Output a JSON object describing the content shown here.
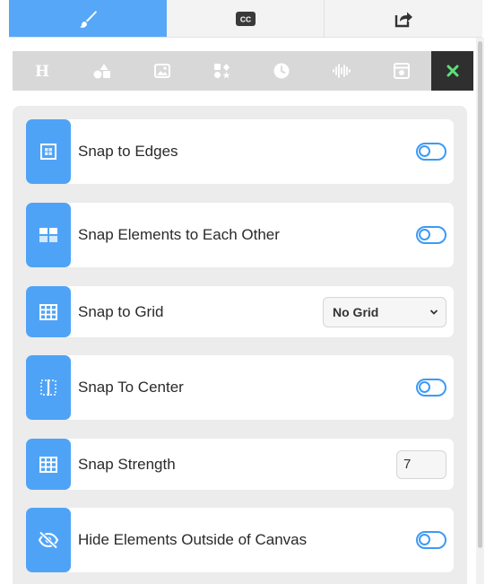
{
  "top_tabs": [
    {
      "icon": "paintbrush-icon",
      "active": true
    },
    {
      "icon": "closed-captions-icon",
      "active": false
    },
    {
      "icon": "share-icon",
      "active": false
    }
  ],
  "toolbar": {
    "tools": [
      "heading-icon",
      "shapes-icon",
      "image-icon",
      "elements-icon",
      "clock-icon",
      "audio-wave-icon",
      "widget-icon"
    ],
    "close_icon": "close-icon"
  },
  "colors": {
    "accent": "#4fa3f7",
    "toolbar_bg": "#d8d8d8",
    "close_bg": "#2f2f2f",
    "close_fg": "#5ee07a"
  },
  "settings": [
    {
      "label": "Snap to Edges",
      "control": "toggle",
      "icon": "snap-edges-icon"
    },
    {
      "label": "Snap Elements to Each Other",
      "control": "toggle",
      "icon": "snap-elements-icon"
    },
    {
      "label": "Snap to Grid",
      "control": "select",
      "value": "No Grid",
      "icon": "grid-icon"
    },
    {
      "label": "Snap To Center",
      "control": "toggle",
      "icon": "snap-center-icon"
    },
    {
      "label": "Snap Strength",
      "control": "number",
      "value": "7",
      "icon": "grid-icon"
    },
    {
      "label": "Hide Elements Outside of Canvas",
      "control": "toggle",
      "icon": "eye-slash-icon"
    }
  ]
}
